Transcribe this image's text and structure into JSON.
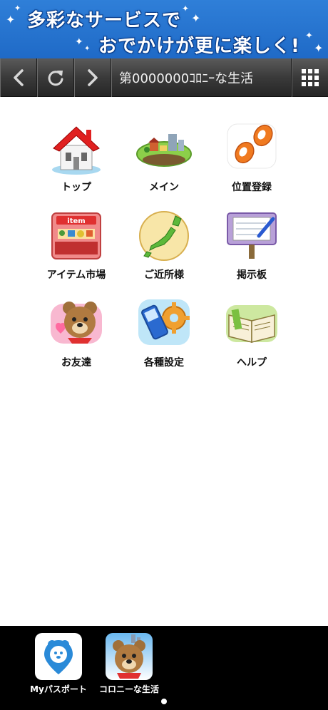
{
  "banner": {
    "line1": "多彩なサービスで",
    "line2": "おでかけが更に楽しく!"
  },
  "toolbar": {
    "back_icon": "chevron-left-icon",
    "reload_icon": "reload-icon",
    "forward_icon": "chevron-right-icon",
    "title": "第0000000ｺﾛﾆｰな生活",
    "menu_icon": "grid-menu-icon"
  },
  "menu": {
    "items": [
      {
        "label": "トップ",
        "icon": "house-icon"
      },
      {
        "label": "メイン",
        "icon": "town-island-icon"
      },
      {
        "label": "位置登録",
        "icon": "footprints-icon"
      },
      {
        "label": "アイテム市場",
        "icon": "item-shop-icon",
        "icon_text": "item"
      },
      {
        "label": "ご近所様",
        "icon": "japan-map-icon"
      },
      {
        "label": "掲示板",
        "icon": "bulletin-board-icon"
      },
      {
        "label": "お友達",
        "icon": "bear-friend-icon"
      },
      {
        "label": "各種設定",
        "icon": "phone-gear-icon"
      },
      {
        "label": "ヘルプ",
        "icon": "open-book-icon"
      }
    ]
  },
  "dock": {
    "items": [
      {
        "label": "Myパスポート",
        "icon": "my-passport-app-icon"
      },
      {
        "label": "コロニーな生活",
        "icon": "colony-life-app-icon"
      }
    ]
  },
  "colors": {
    "banner_blue": "#2f7fd8",
    "toolbar_dark": "#3a3a3a",
    "dock_black": "#000000"
  }
}
